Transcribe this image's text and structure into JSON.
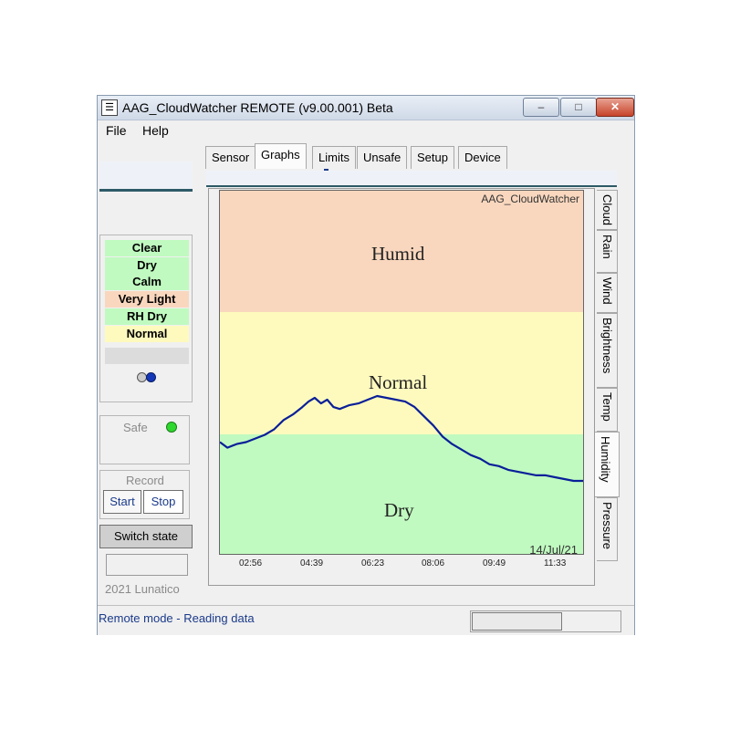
{
  "window": {
    "title": "AAG_CloudWatcher REMOTE (v9.00.001) Beta",
    "buttons": {
      "minimize": "–",
      "maximize": "□",
      "close": "✕"
    }
  },
  "menu": [
    "File",
    "Help"
  ],
  "tabs": [
    "Sensor",
    "Graphs",
    "Limits",
    "Unsafe",
    "Setup",
    "Device"
  ],
  "active_tab": "Graphs",
  "vertical_tabs": [
    "Cloud",
    "Rain",
    "Wind",
    "Brightness",
    "Temp",
    "Humidity",
    "Pressure"
  ],
  "active_vertical_tab": "Humidity",
  "conditions": [
    {
      "label": "Clear",
      "color": "#c0fac0"
    },
    {
      "label": "Dry",
      "color": "#c0fac0"
    },
    {
      "label": "Calm",
      "color": "#c0fac0"
    },
    {
      "label": "Very Light",
      "color": "#f9d7be"
    },
    {
      "label": "RH Dry",
      "color": "#c0fac0"
    },
    {
      "label": "Normal",
      "color": "#fefabe"
    }
  ],
  "safe": {
    "label": "Safe",
    "led_color": "#2ed82e"
  },
  "record": {
    "label": "Record",
    "start": "Start",
    "stop": "Stop"
  },
  "switch_state_label": "Switch state",
  "copyright": "2021 Lunatico",
  "status_text": "Remote mode - Reading data",
  "graph": {
    "watermark": "AAG_CloudWatcher",
    "date": "14/Jul/21",
    "bands": [
      "Humid",
      "Normal",
      "Dry"
    ],
    "x_ticks": [
      "02:56",
      "04:39",
      "06:23",
      "08:06",
      "09:49",
      "11:33"
    ]
  },
  "chart_data": {
    "type": "line",
    "title": "",
    "xlabel": "",
    "ylabel": "",
    "x_ticks": [
      "02:56",
      "04:39",
      "06:23",
      "08:06",
      "09:49",
      "11:33"
    ],
    "bands": [
      {
        "name": "Humid",
        "color": "#f9d7be"
      },
      {
        "name": "Normal",
        "color": "#fefabe"
      },
      {
        "name": "Dry",
        "color": "#c0fac0"
      }
    ],
    "series": [
      {
        "color": "#0a1f99",
        "x": [
          "02:18",
          "02:30",
          "02:45",
          "03:00",
          "03:15",
          "03:30",
          "03:45",
          "04:00",
          "04:15",
          "04:30",
          "04:40",
          "04:50",
          "05:00",
          "05:10",
          "05:20",
          "05:30",
          "05:45",
          "06:00",
          "06:15",
          "06:30",
          "06:45",
          "07:00",
          "07:15",
          "07:30",
          "07:45",
          "08:00",
          "08:15",
          "08:30",
          "08:45",
          "09:00",
          "09:15",
          "09:30",
          "09:45",
          "10:00",
          "10:15",
          "10:30",
          "10:45",
          "11:00",
          "11:15",
          "11:30",
          "11:45",
          "12:00"
        ],
        "y": [
          0.21,
          0.18,
          0.2,
          0.21,
          0.23,
          0.25,
          0.28,
          0.33,
          0.36,
          0.4,
          0.43,
          0.45,
          0.42,
          0.44,
          0.4,
          0.39,
          0.41,
          0.42,
          0.44,
          0.46,
          0.45,
          0.44,
          0.43,
          0.4,
          0.35,
          0.3,
          0.24,
          0.2,
          0.17,
          0.14,
          0.12,
          0.09,
          0.08,
          0.06,
          0.05,
          0.04,
          0.03,
          0.03,
          0.02,
          0.01,
          0.0,
          0.0
        ]
      }
    ]
  }
}
